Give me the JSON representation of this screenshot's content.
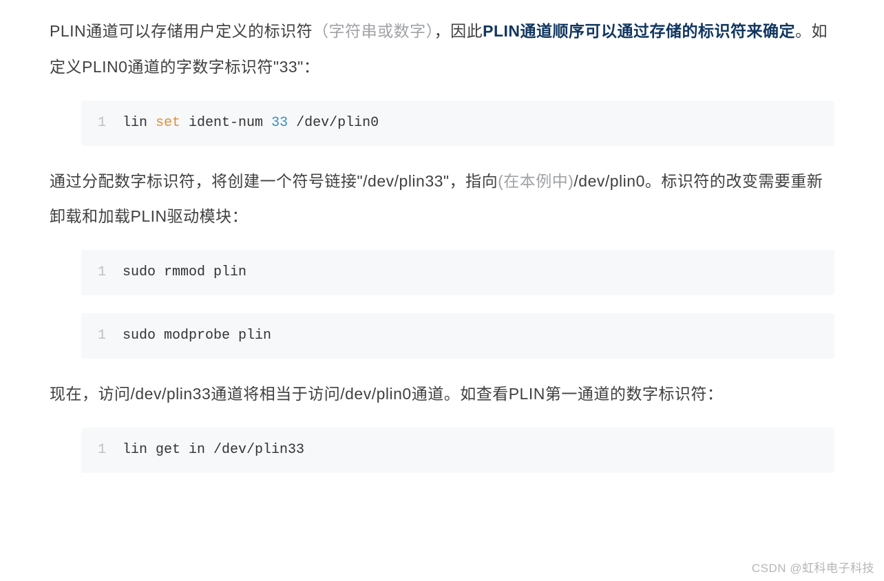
{
  "paragraphs": {
    "p1": {
      "part1": "PLIN通道可以存储用户定义的标识符",
      "muted": "（字符串或数字）",
      "part2": "，因此",
      "bold": "PLIN通道顺序可以通过存储的标识符来确定",
      "part3": "。如定义PLIN0通道的字数字标识符\"33\"："
    },
    "p2": {
      "part1": "通过分配数字标识符，将创建一个符号链接\"/dev/plin33\"，指向",
      "muted": "(在本例中)",
      "part2": "/dev/plin0。标识符的改变需要重新卸载和加载PLIN驱动模块："
    },
    "p3": {
      "text": "现在，访问/dev/plin33通道将相当于访问/dev/plin0通道。如查看PLIN第一通道的数字标识符："
    }
  },
  "code": {
    "c1": {
      "lineno": "1",
      "t1": "lin ",
      "kw": "set",
      "t2": " ident-num ",
      "num": "33",
      "t3": " /dev/plin0"
    },
    "c2": {
      "lineno": "1",
      "text": "sudo rmmod plin"
    },
    "c3": {
      "lineno": "1",
      "text": "sudo modprobe plin"
    },
    "c4": {
      "lineno": "1",
      "text": "lin get in /dev/plin33"
    }
  },
  "watermark": "CSDN @虹科电子科技"
}
